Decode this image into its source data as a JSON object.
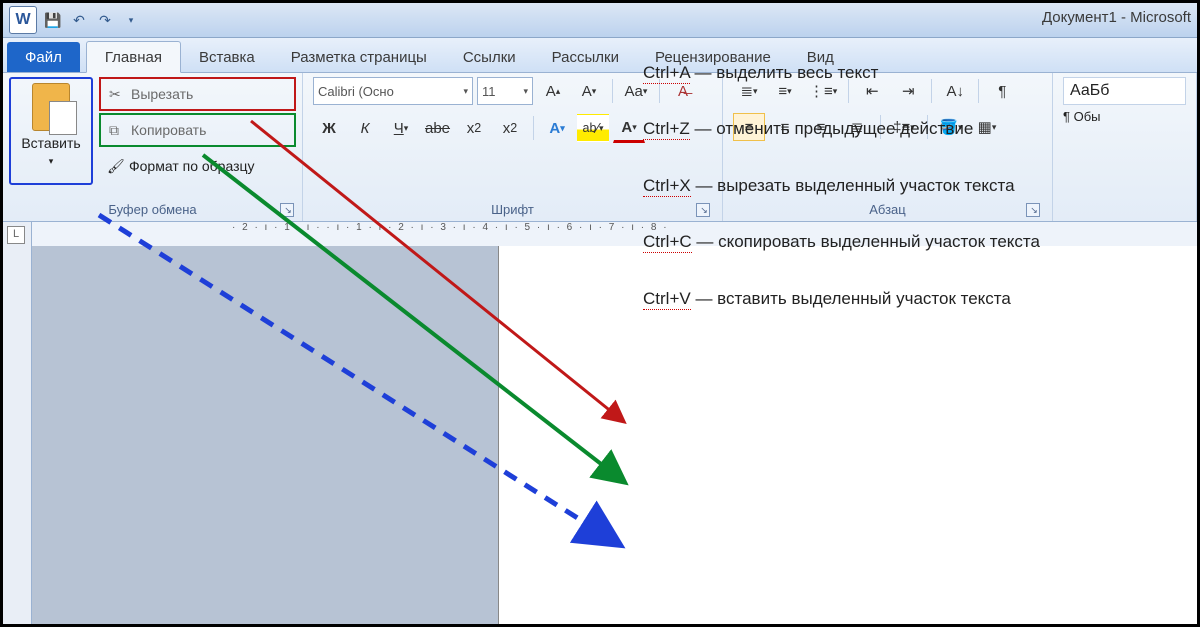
{
  "title": "Документ1 - Microsoft",
  "tabs": {
    "file": "Файл",
    "home": "Главная",
    "insert": "Вставка",
    "layout": "Разметка страницы",
    "refs": "Ссылки",
    "mail": "Рассылки",
    "review": "Рецензирование",
    "view": "Вид"
  },
  "clipboard": {
    "paste": "Вставить",
    "cut": "Вырезать",
    "copy": "Копировать",
    "format": "Формат по образцу",
    "group": "Буфер обмена"
  },
  "font": {
    "name": "Calibri (Осно",
    "size": "11",
    "group": "Шрифт"
  },
  "para": {
    "group": "Абзац"
  },
  "styles": {
    "box1": "АаБб",
    "box2": "¶ Обы"
  },
  "ruler_h": "· 2 · ı · 1 · ı ·   · ı · 1 · ı · 2 · ı · 3 · ı · 4 · ı · 5 · ı · 6 · ı · 7 · ı · 8 ·",
  "shortcuts": [
    {
      "k": "Ctrl+A",
      "t": " — выделить весь текст"
    },
    {
      "k": "Ctrl+Z",
      "t": " — отменить предыдущее действие"
    },
    {
      "k": "Ctrl+X",
      "t": " — вырезать выделенный участок текста"
    },
    {
      "k": "Ctrl+C",
      "t": " — скопировать выделенный участок текста"
    },
    {
      "k": "Ctrl+V",
      "t": " — вставить выделенный участок текста"
    }
  ],
  "annotations": {
    "highlight_paste": "blue-box",
    "highlight_cut": "red-box",
    "highlight_copy": "green-box",
    "arrows": [
      {
        "color": "#c01818",
        "style": "solid",
        "target": "Ctrl+X"
      },
      {
        "color": "#0a8a2e",
        "style": "solid",
        "target": "Ctrl+C"
      },
      {
        "color": "#1e3fd8",
        "style": "dashed",
        "target": "Ctrl+V"
      }
    ]
  }
}
